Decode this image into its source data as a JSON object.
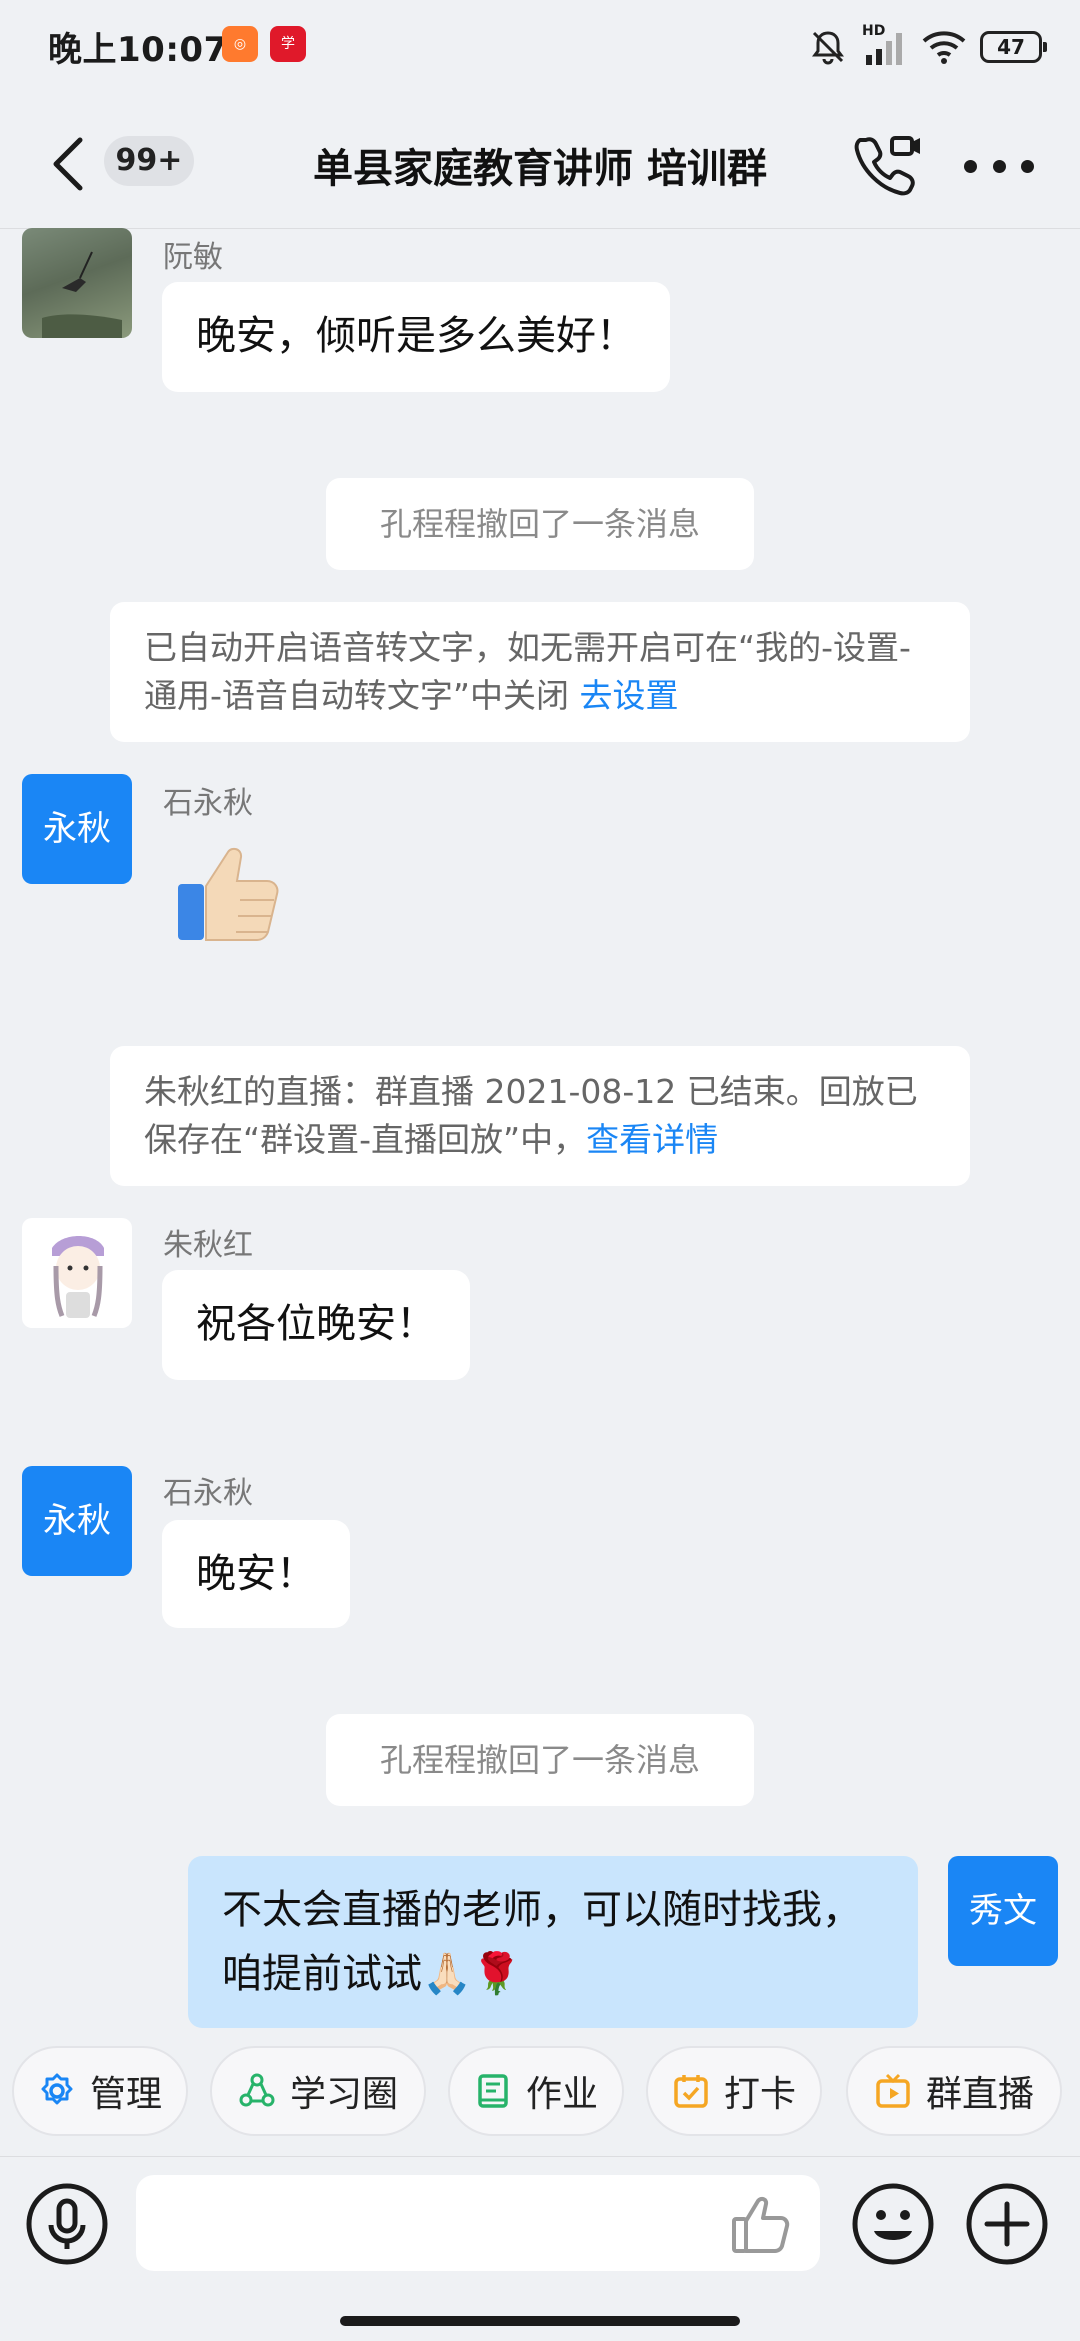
{
  "status_bar": {
    "time": "晚上10:07",
    "battery": "47",
    "network": "HD"
  },
  "header": {
    "unread_badge": "99+",
    "title": "单县家庭教育讲师 培训群"
  },
  "messages": {
    "m1": {
      "sender": "阮敏",
      "text": "晚安，倾听是多么美好！"
    },
    "sys1": {
      "text": "孔程程撤回了一条消息"
    },
    "notice1": {
      "text": "已自动开启语音转文字，如无需开启可在“我的-设置-通用-语音自动转文字”中关闭",
      "link": "去设置"
    },
    "m2": {
      "sender": "石永秋",
      "avatar_text": "永秋",
      "emoji": "👍"
    },
    "notice2": {
      "text": "朱秋红的直播：群直播 2021-08-12 已结束。回放已保存在“群设置-直播回放”中，",
      "link": "查看详情"
    },
    "m3": {
      "sender": "朱秋红",
      "text": "祝各位晚安！"
    },
    "m4": {
      "sender": "石永秋",
      "avatar_text": "永秋",
      "text": "晚安！"
    },
    "sys2": {
      "text": "孔程程撤回了一条消息"
    },
    "m5": {
      "avatar_text": "秀文",
      "text": "不太会直播的老师，可以随时找我，咱提前试试🙏🏻🌹"
    }
  },
  "quick_actions": [
    {
      "label": "管理",
      "icon": "gear-icon",
      "color": "#1a86f5"
    },
    {
      "label": "学习圈",
      "icon": "circle-nodes-icon",
      "color": "#27b36a"
    },
    {
      "label": "作业",
      "icon": "book-icon",
      "color": "#27b36a"
    },
    {
      "label": "打卡",
      "icon": "calendar-check-icon",
      "color": "#f5a623"
    },
    {
      "label": "群直播",
      "icon": "live-tv-icon",
      "color": "#f5a623"
    }
  ],
  "colors": {
    "accent": "#1a86f5",
    "my_bubble": "#c9e5fd",
    "background": "#eff1f4"
  }
}
